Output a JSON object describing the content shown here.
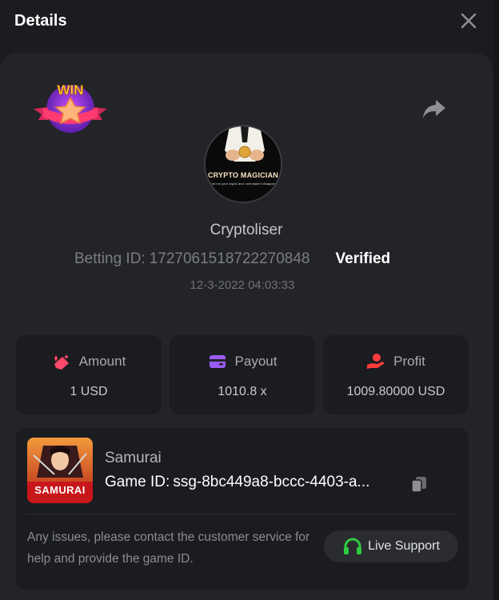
{
  "header": {
    "title": "Details",
    "close_icon": "close-icon"
  },
  "badge": {
    "text": "WIN",
    "icon": "win-star-badge"
  },
  "profile": {
    "avatar_title": "CRYPTO MAGICIAN",
    "avatar_subtitle": "send me your crypto and I will make it disappear!",
    "username": "Cryptoliser",
    "betting_label": "Betting ID:",
    "betting_id": "1727061518722270848",
    "verified": "Verified",
    "datetime": "12-3-2022 04:03:33"
  },
  "stats": [
    {
      "label": "Amount",
      "value": "1 USD",
      "icon": "amount-icon",
      "color": "#ff4a6b"
    },
    {
      "label": "Payout",
      "value": "1010.8 x",
      "icon": "card-icon",
      "color": "#9b5cf5"
    },
    {
      "label": "Profit",
      "value": "1009.80000 USD",
      "icon": "profit-hand-icon",
      "color": "#ff3b3b"
    }
  ],
  "game": {
    "name": "Samurai",
    "thumb_label": "SAMURAI",
    "id_label": "Game ID:",
    "id_value": "ssg-8bc449a8-bccc-4403-a...",
    "support_text": "Any issues, please contact the customer service for help and provide the game ID.",
    "live_support": "Live Support",
    "support_icon_color": "#2ecc40"
  },
  "colors": {
    "background": "#1b1c20",
    "panel": "#232428",
    "accent_red": "#ff4a6b",
    "accent_purple": "#9b5cf5"
  }
}
